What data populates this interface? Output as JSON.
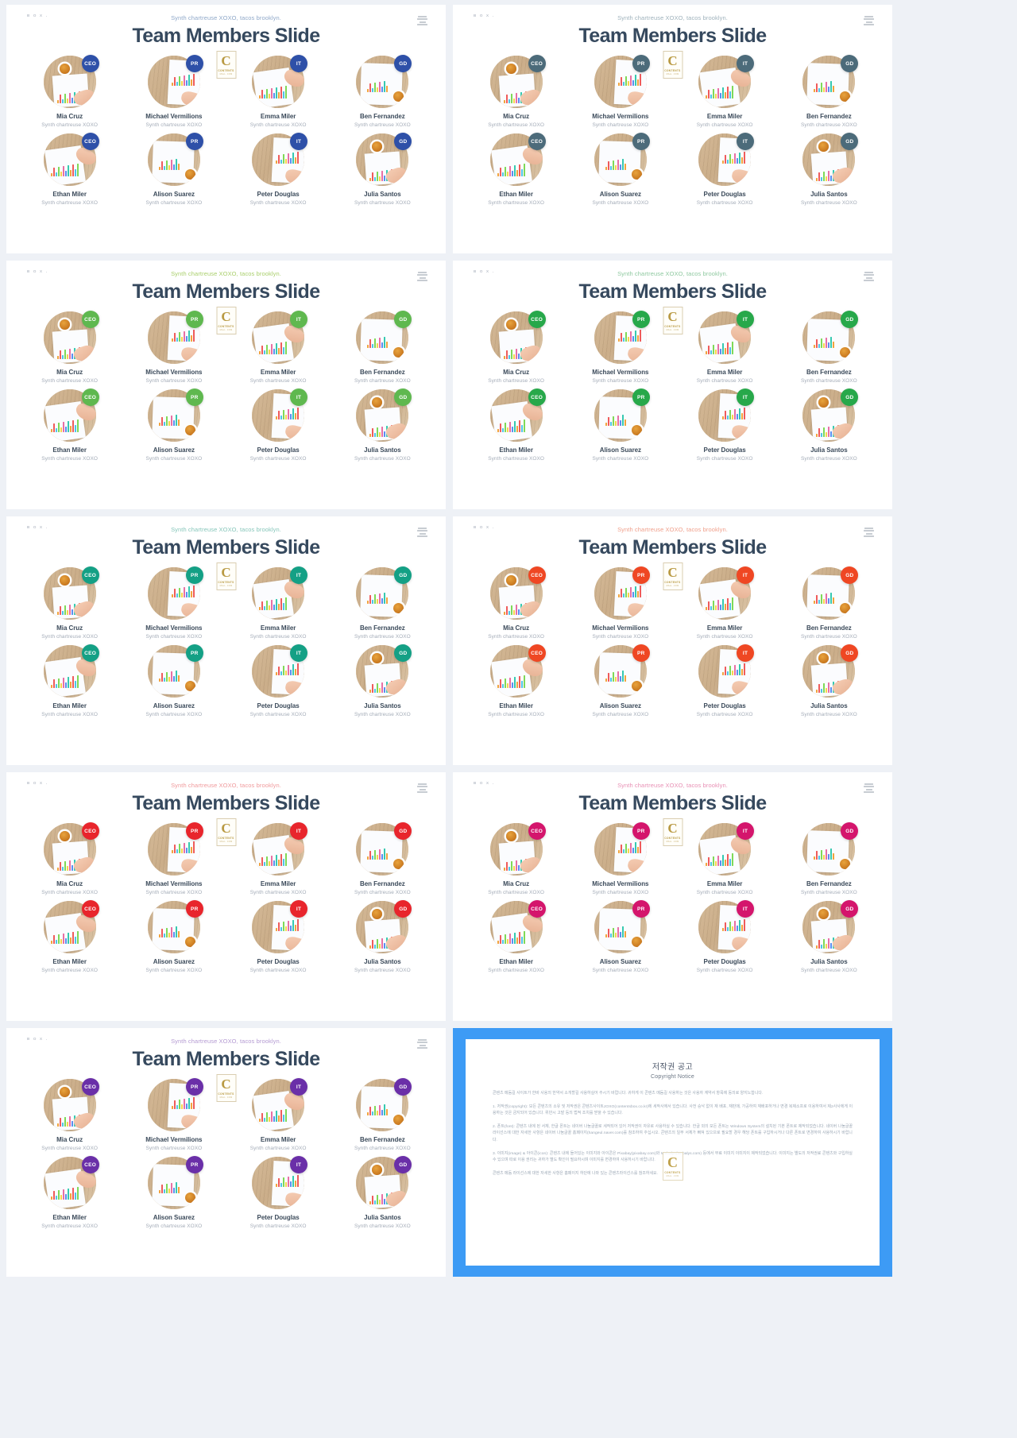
{
  "page": {
    "background": "#eef1f6",
    "title_text": "Team Members Slide",
    "kicker_text": "Synth chartreuse XOXO, tacos brooklyn.",
    "brand_mini": "B O X .",
    "logo_icon": "stacked-layers-logo-icon",
    "center_logo": {
      "glyph": "C",
      "line1": "CONTENTS",
      "line2": "MALL .COM"
    }
  },
  "roles": {
    "ceo": "CEO",
    "pr": "PR",
    "it": "IT",
    "gd": "GD"
  },
  "member_role": "Synth chartreuse XOXO",
  "members": [
    {
      "name": "Mia Cruz",
      "role_key": "ceo",
      "avatar": "a"
    },
    {
      "name": "Michael Vermilions",
      "role_key": "pr",
      "avatar": "b"
    },
    {
      "name": "Emma Miler",
      "role_key": "it",
      "avatar": "c"
    },
    {
      "name": "Ben  Fernandez",
      "role_key": "gd",
      "avatar": "d"
    },
    {
      "name": "Ethan Miler",
      "role_key": "ceo",
      "avatar": "c"
    },
    {
      "name": "Alison Suarez",
      "role_key": "pr",
      "avatar": "d"
    },
    {
      "name": "Peter Douglas",
      "role_key": "it",
      "avatar": "b"
    },
    {
      "name": "Julia Santos",
      "role_key": "gd",
      "avatar": "a"
    }
  ],
  "slides": [
    {
      "id": 1,
      "accent": "#2e50a8",
      "badge": "#2e50a8",
      "kicker_color": "#8fa8c9"
    },
    {
      "id": 2,
      "accent": "#4c6b7a",
      "badge": "#4c6b7a",
      "kicker_color": "#9fb2bc"
    },
    {
      "id": 3,
      "accent": "#5fb84f",
      "badge": "#5fb84f",
      "kicker_color": "#a9cf6b"
    },
    {
      "id": 4,
      "accent": "#27a84a",
      "badge": "#27a84a",
      "kicker_color": "#8fc9a0"
    },
    {
      "id": 5,
      "accent": "#14a085",
      "badge": "#14a085",
      "kicker_color": "#86c6ba"
    },
    {
      "id": 6,
      "accent": "#ef4723",
      "badge": "#ef4723",
      "kicker_color": "#f0a08c"
    },
    {
      "id": 7,
      "accent": "#e8252c",
      "badge": "#e8252c",
      "kicker_color": "#f09a9c"
    },
    {
      "id": 8,
      "accent": "#d4156c",
      "badge": "#d4156c",
      "kicker_color": "#e890b5"
    },
    {
      "id": 9,
      "accent": "#6a2fa8",
      "badge": "#6a2fa8",
      "kicker_color": "#b49ad2"
    }
  ],
  "copyright": {
    "frame_color": "#3d9bf5",
    "title": "저작권 공고",
    "subtitle": "Copyright Notice",
    "paragraphs": [
      "콘텐츠 메듬길 사이트가 한바 사용의 한약서 소개할길 사용하실어 주시기 바랍니다. 귀하게 이 콘텐츠 메듬길 사용하는 것은 사용자 계약서 항목에 동의로 양지노합니다.",
      "1. 저작권(copyright): 모든 콘텐츠의 소유 및 저작권은 콘텐츠사이트JOXO(contentsbox.co.kr)에 세작사에서 있습니다. 사전 승낙 없이 재 배포, 재판매, 가공하여 재배포하거나 변경 복제소프로 이용하여서 제2사사에게 이용하는 것은 금지되어 있습니다. 위반시 고발 등의 법적 조치를 받을 수 있습니다.",
      "2. 폰트(font): 콘텐츠 내에 된 서체, 한글 폰트는 네이버 나눔글꼴로 세작되어 있어 저작권이 자유로 사용하실 수 있습니다. 한글 외의 모든 폰트는 Windows System의 설치된 기본 폰트로 제작되었습니다. 네이버 나눔글꼴 라이선스에 대한 자세한 사항은 네이버 나눔글꼴 홈페이지(hangeul.naver.com)를 참조하여 주십시오. 콘텐츠의 일부 서체가 빠져 있으므로 필요할 경우 해당 폰트를 구입하시거나 다른 폰트로 변경하여 사용하시기 바랍니다.",
      "3. 이미지(image) & 아이콘(icon): 콘텐츠 내에 들어있는 이미지와 아이콘은 Pixabay(pixabay.com)와 Webalys(webalys.com) 등에서 무료 이미지 이미지이 제작되었습니다. 이미지는 별도의 저작권료 콘텐츠와 구입하실 수 있으며 따로 이용 권리는 귀하가 별도 확인이 필요하시며 이미지를 변경하여 사용하시기 바랍니다.",
      "콘텐츠 메듬 라이선스에 대한 자세한 사항은 홈페이지 하단에 나와 있는 콘텐츠라이선스를 참조하세요."
    ]
  }
}
